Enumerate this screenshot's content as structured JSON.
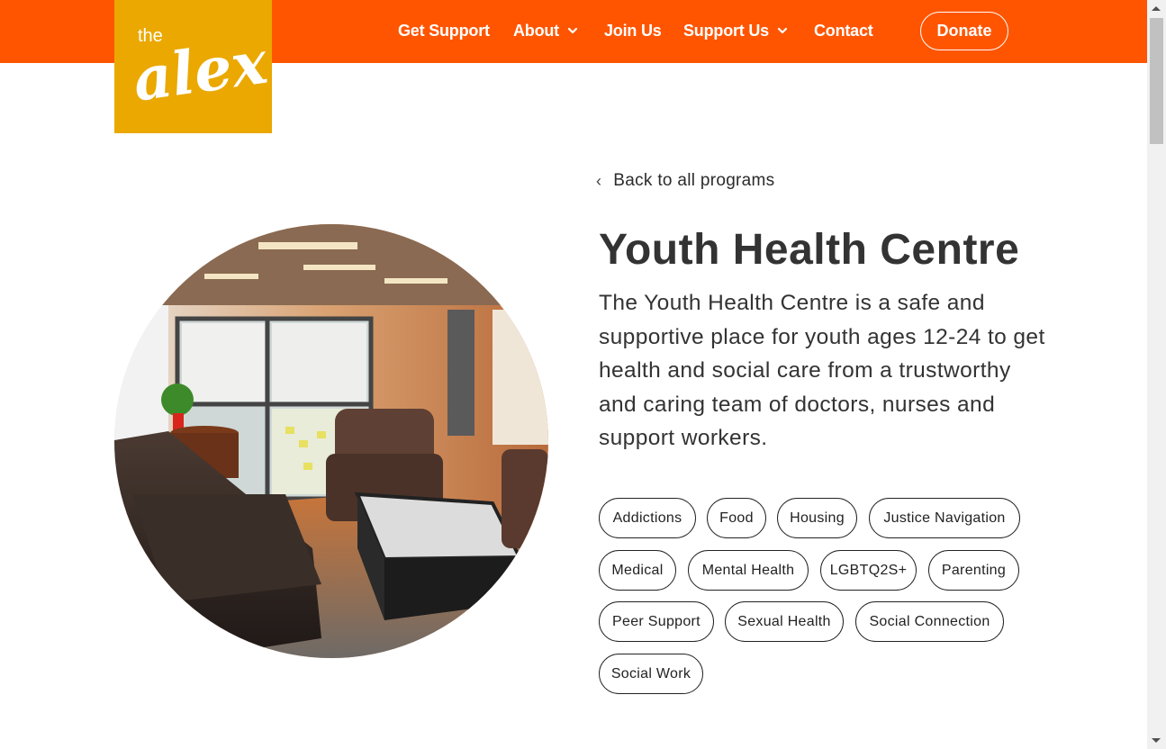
{
  "brand": {
    "logo_small": "the",
    "logo_big": "alex.",
    "logo_bg": "#eaa800",
    "header_bg": "#ff5500"
  },
  "nav": {
    "items": [
      {
        "label": "Get Support",
        "has_dropdown": false
      },
      {
        "label": "About",
        "has_dropdown": true
      },
      {
        "label": "Join Us",
        "has_dropdown": false
      },
      {
        "label": "Support Us",
        "has_dropdown": true
      },
      {
        "label": "Contact",
        "has_dropdown": false
      }
    ],
    "donate_label": "Donate"
  },
  "content": {
    "back_label": "Back to all programs",
    "title": "Youth Health Centre",
    "description": "The Youth Health Centre is a safe and supportive place for youth ages 12-24 to get health and social care from a trustworthy and caring team of doctors, nurses and support workers.",
    "tags": [
      "Addictions",
      "Food",
      "Housing",
      "Justice Navigation",
      "Medical",
      "Mental Health",
      "LGBTQ2S+",
      "Parenting",
      "Peer Support",
      "Sexual Health",
      "Social Connection",
      "Social Work"
    ]
  }
}
